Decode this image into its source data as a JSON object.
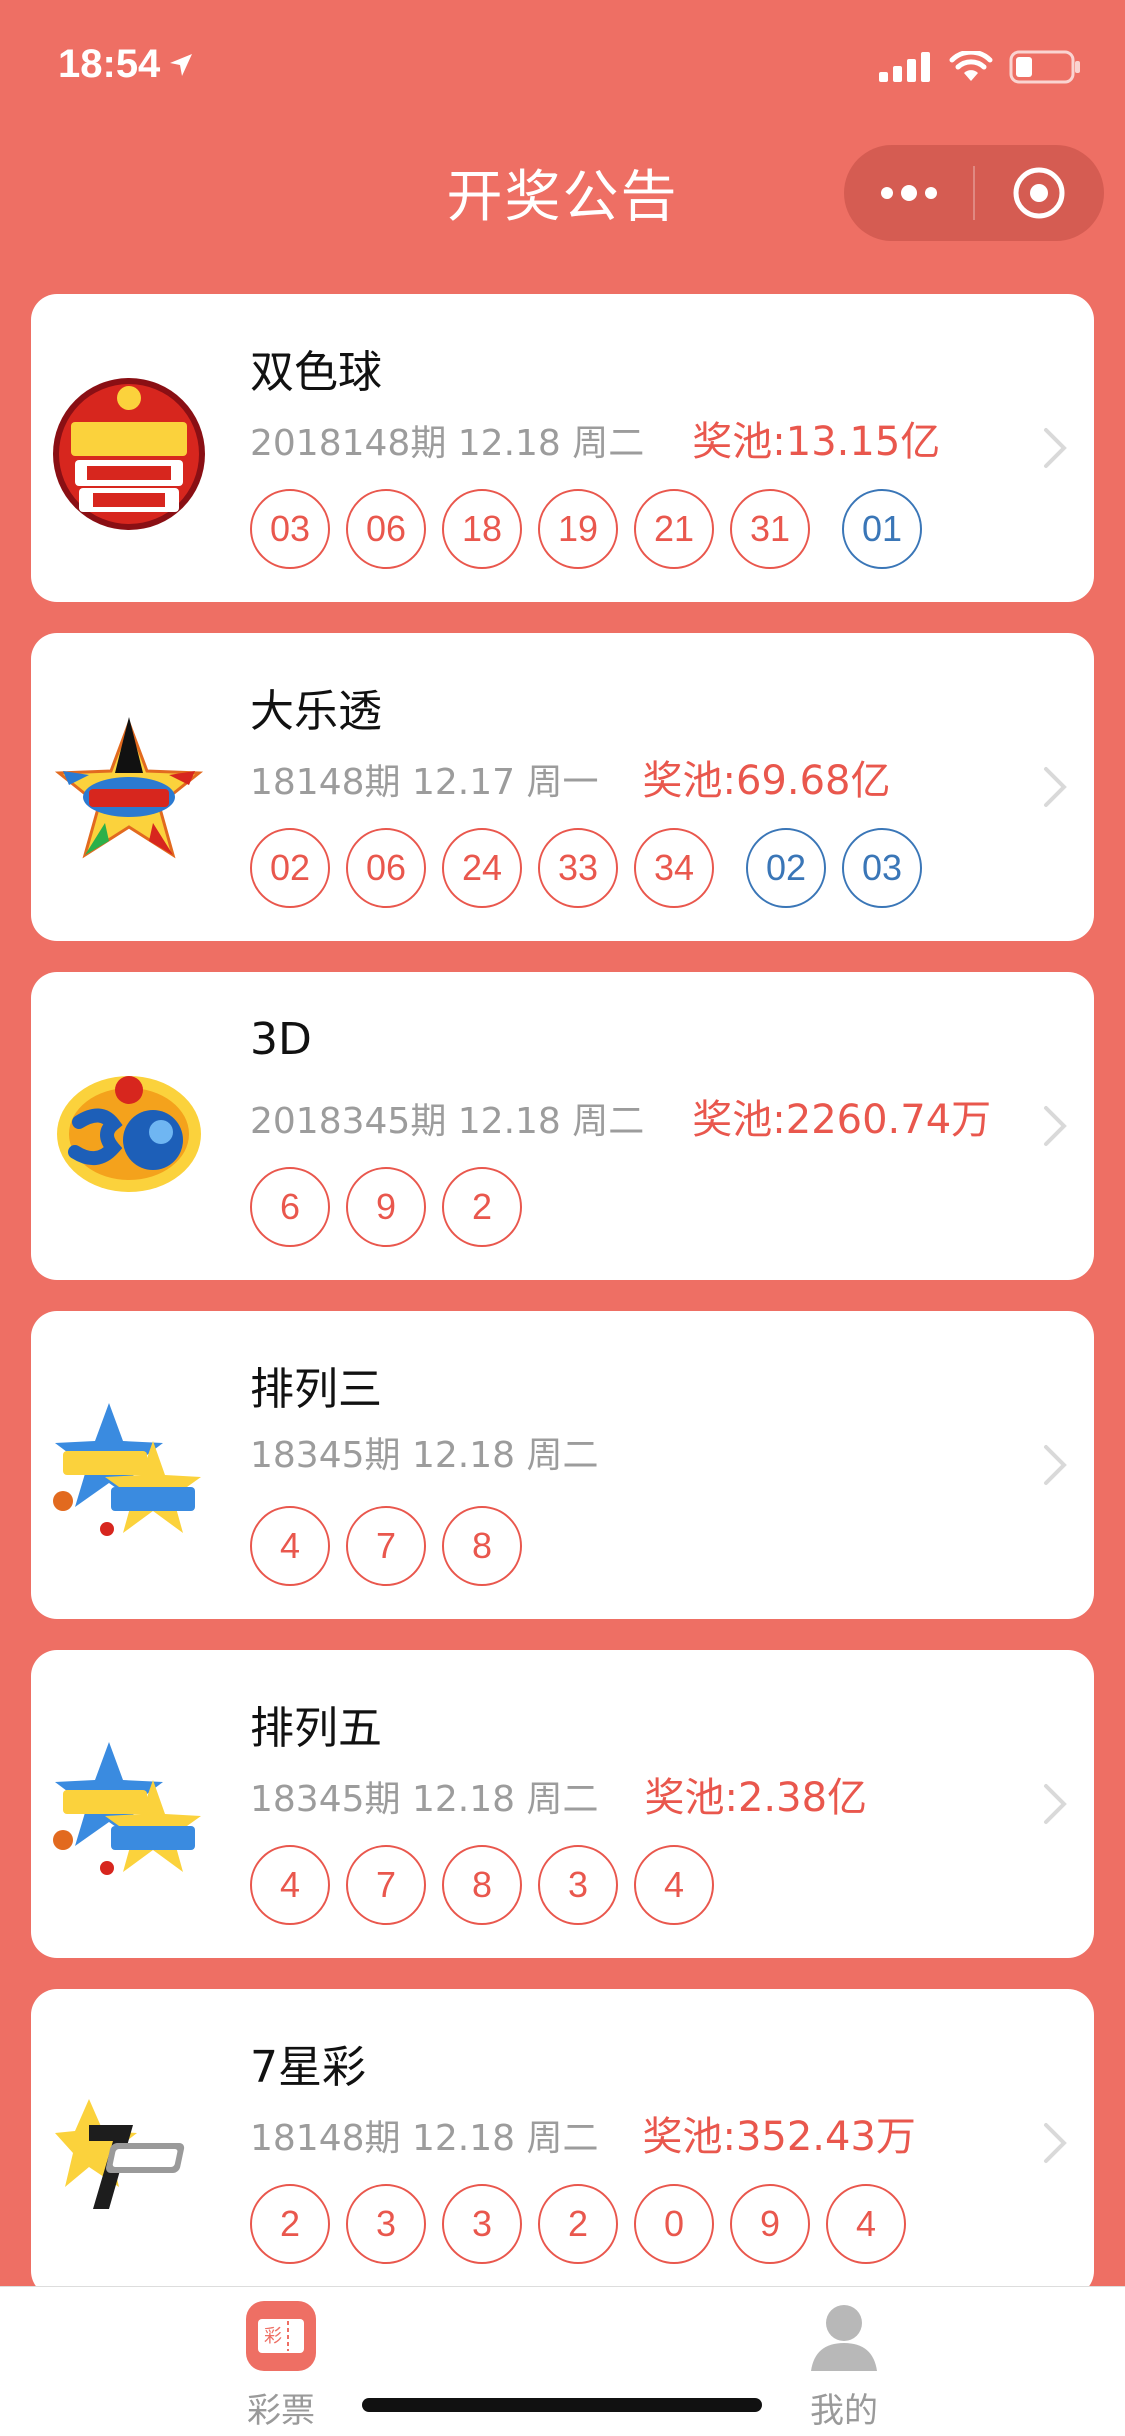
{
  "status": {
    "time": "18:54"
  },
  "header": {
    "title": "开奖公告"
  },
  "lotteries": [
    {
      "name": "双色球",
      "issue": "2018148期 12.18 周二",
      "pool": "奖池:13.15亿",
      "red": [
        "03",
        "06",
        "18",
        "19",
        "21",
        "31"
      ],
      "blue": [
        "01"
      ],
      "logo": "union-lotto-logo"
    },
    {
      "name": "大乐透",
      "issue": "18148期 12.17 周一",
      "pool": "奖池:69.68亿",
      "red": [
        "02",
        "06",
        "24",
        "33",
        "34"
      ],
      "blue": [
        "02",
        "03"
      ],
      "logo": "daletou-logo"
    },
    {
      "name": "3D",
      "issue": "2018345期 12.18 周二",
      "pool": "奖池:2260.74万",
      "red": [
        "6",
        "9",
        "2"
      ],
      "blue": [],
      "logo": "3d-logo"
    },
    {
      "name": "排列三",
      "issue": "18345期 12.18 周二",
      "pool": "",
      "red": [
        "4",
        "7",
        "8"
      ],
      "blue": [],
      "logo": "pailie-logo"
    },
    {
      "name": "排列五",
      "issue": "18345期 12.18 周二",
      "pool": "奖池:2.38亿",
      "red": [
        "4",
        "7",
        "8",
        "3",
        "4"
      ],
      "blue": [],
      "logo": "pailie-logo"
    },
    {
      "name": "7星彩",
      "issue": "18148期 12.18 周二",
      "pool": "奖池:352.43万",
      "red": [
        "2",
        "3",
        "3",
        "2",
        "0",
        "9",
        "4"
      ],
      "blue": [],
      "logo": "7xingcai-logo"
    }
  ],
  "tabbar": {
    "items": [
      {
        "label": "彩票",
        "icon_char": "彩",
        "active": true
      },
      {
        "label": "我的",
        "active": false
      }
    ]
  },
  "colors": {
    "primary": "#ee6f64",
    "red_ball": "#e9574d",
    "blue_ball": "#3a76b7"
  }
}
